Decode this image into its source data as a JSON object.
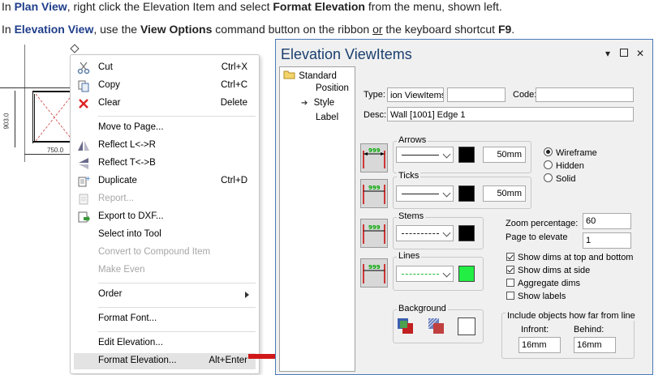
{
  "instructions": {
    "line1": {
      "p1": "In ",
      "b1": "Plan View",
      "p2": ", right click the Elevation Item and select ",
      "b2": "Format Elevation",
      "p3": " from the menu, shown left."
    },
    "line2": {
      "p1": "In ",
      "b1": "Elevation View",
      "p2": ", use the ",
      "b2": "View Options",
      "p3": " command button on the ribbon ",
      "u1": "or",
      "p4": " the keyboard shortcut ",
      "b3": "F9",
      "p5": "."
    }
  },
  "plan": {
    "dim_vertical": "903.0",
    "dim_horizontal": "750.0"
  },
  "context_menu": {
    "cut": {
      "label": "Cut",
      "shortcut": "Ctrl+X"
    },
    "copy": {
      "label": "Copy",
      "shortcut": "Ctrl+C"
    },
    "clear": {
      "label": "Clear",
      "shortcut": "Delete"
    },
    "move_to_page": {
      "label": "Move to Page..."
    },
    "reflect_lr": {
      "label": "Reflect L<->R"
    },
    "reflect_tb": {
      "label": "Reflect T<->B"
    },
    "duplicate": {
      "label": "Duplicate",
      "shortcut": "Ctrl+D"
    },
    "report": {
      "label": "Report..."
    },
    "export_dxf": {
      "label": "Export to DXF..."
    },
    "select_into_tool": {
      "label": "Select into Tool"
    },
    "convert_compound": {
      "label": "Convert to Compound Item"
    },
    "make_even": {
      "label": "Make Even"
    },
    "order": {
      "label": "Order"
    },
    "format_font": {
      "label": "Format Font..."
    },
    "edit_elevation": {
      "label": "Edit Elevation..."
    },
    "format_elevation": {
      "label": "Format Elevation...",
      "shortcut": "Alt+Enter"
    }
  },
  "dialog": {
    "title": "Elevation ViewItems",
    "tree": {
      "root": "Standard",
      "items": [
        "Position",
        "Style",
        "Label"
      ],
      "selected": "Style"
    },
    "type_label": "Type:",
    "type_value": "ion ViewItems",
    "type_value2": "",
    "code_label": "Code:",
    "code_value": "",
    "desc_label": "Desc:",
    "desc_value": "Wall [1001] Edge 1",
    "arrows": {
      "label": "Arrows",
      "size": "50mm",
      "swatch_color": "#000000"
    },
    "ticks": {
      "label": "Ticks",
      "size": "50mm",
      "swatch_color": "#000000"
    },
    "stems": {
      "label": "Stems",
      "swatch_color": "#000000"
    },
    "lines": {
      "label": "Lines",
      "swatch_color": "#22ee44"
    },
    "preview_text": "999",
    "render_options": {
      "items": [
        "Wireframe",
        "Hidden",
        "Solid"
      ],
      "selected": "Wireframe"
    },
    "zoom": {
      "label": "Zoom percentage:",
      "value": "60"
    },
    "page_to_elevate": {
      "label": "Page to elevate",
      "value": "1"
    },
    "checkboxes": [
      {
        "label": "Show dims at top and bottom",
        "checked": true
      },
      {
        "label": "Show dims at side",
        "checked": true
      },
      {
        "label": "Aggregate dims",
        "checked": false
      },
      {
        "label": "Show labels",
        "checked": false
      }
    ],
    "background": {
      "label": "Background"
    },
    "include": {
      "label": "Include objects how far from line",
      "infront_label": "Infront:",
      "infront_value": "16mm",
      "behind_label": "Behind:",
      "behind_value": "16mm"
    }
  }
}
